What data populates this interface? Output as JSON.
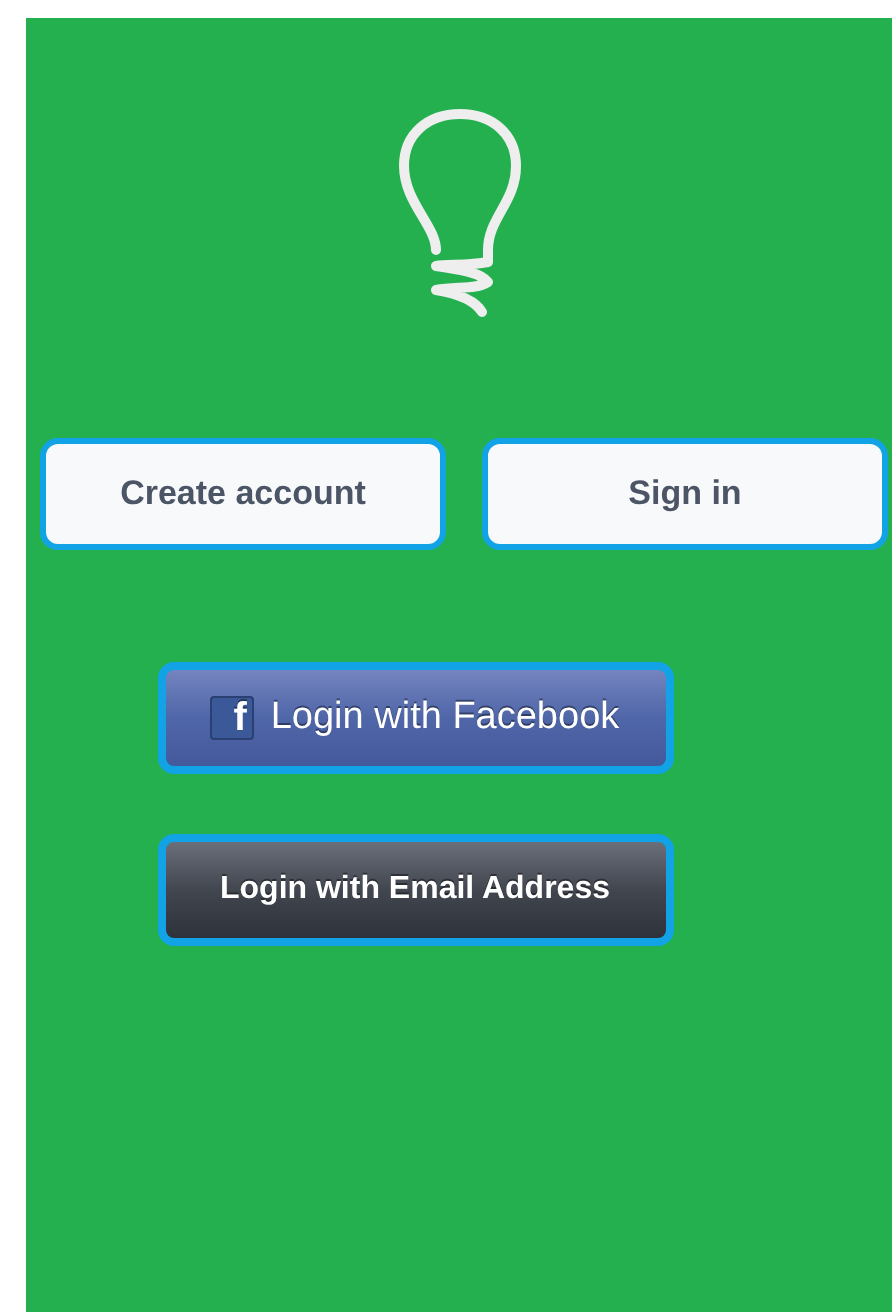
{
  "auth_buttons": [
    {
      "label": "Create account"
    },
    {
      "label": "Sign in"
    }
  ],
  "social_buttons": [
    {
      "kind": "facebook",
      "logo_letter": "f",
      "label": "Login with Facebook"
    },
    {
      "kind": "email",
      "label": "Login with Email Address"
    }
  ]
}
